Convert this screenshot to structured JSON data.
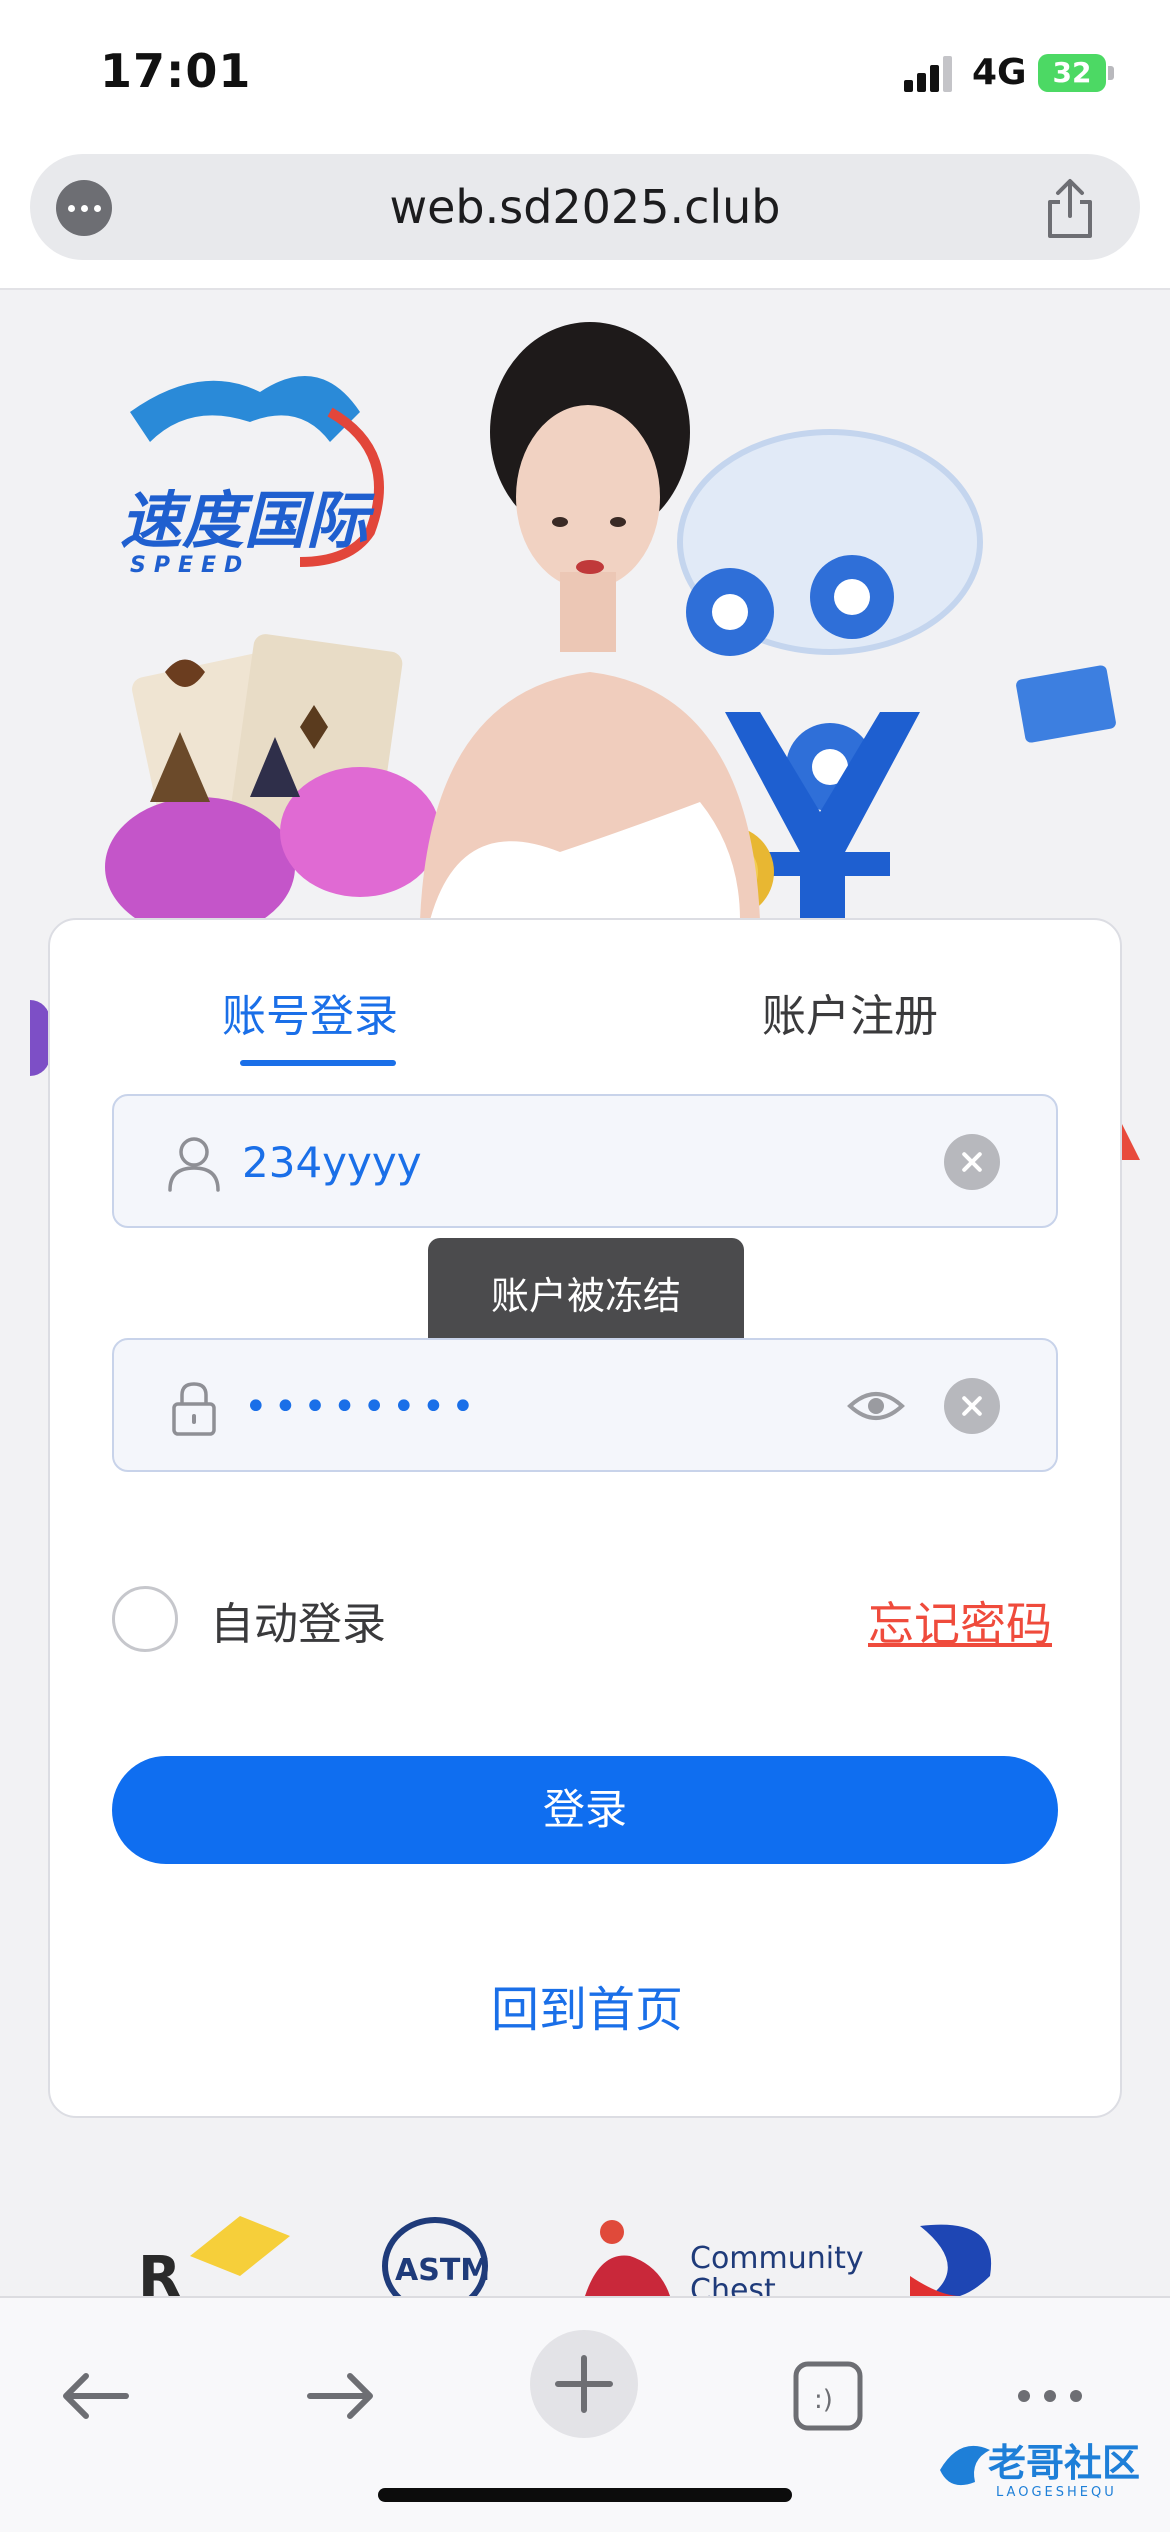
{
  "status_bar": {
    "time": "17:01",
    "network": "4G",
    "battery": "32"
  },
  "browser": {
    "url": "web.sd2025.club"
  },
  "banner": {
    "logo_text": "速度国际",
    "logo_sub": "SPEED"
  },
  "login_card": {
    "tabs": [
      {
        "label": "账号登录",
        "active": true
      },
      {
        "label": "账户注册",
        "active": false
      }
    ],
    "username_value": "234yyyy",
    "password_mask": "••••••••",
    "toast": "账户被冻结",
    "remember_label": "自动登录",
    "forgot_label": "忘记密码",
    "login_button": "登录",
    "home_link": "回到首页"
  },
  "partners": {
    "community_label_1": "Community",
    "community_label_2": "Chest",
    "astm_label": "ASTM"
  },
  "watermark": {
    "text": "老哥社区",
    "sub": "LAOGESHEQU"
  },
  "colors": {
    "accent": "#0f6ef0",
    "link_blue": "#1a6fe8",
    "forgot_red": "#ef4b3c",
    "battery_green": "#4cd964"
  }
}
